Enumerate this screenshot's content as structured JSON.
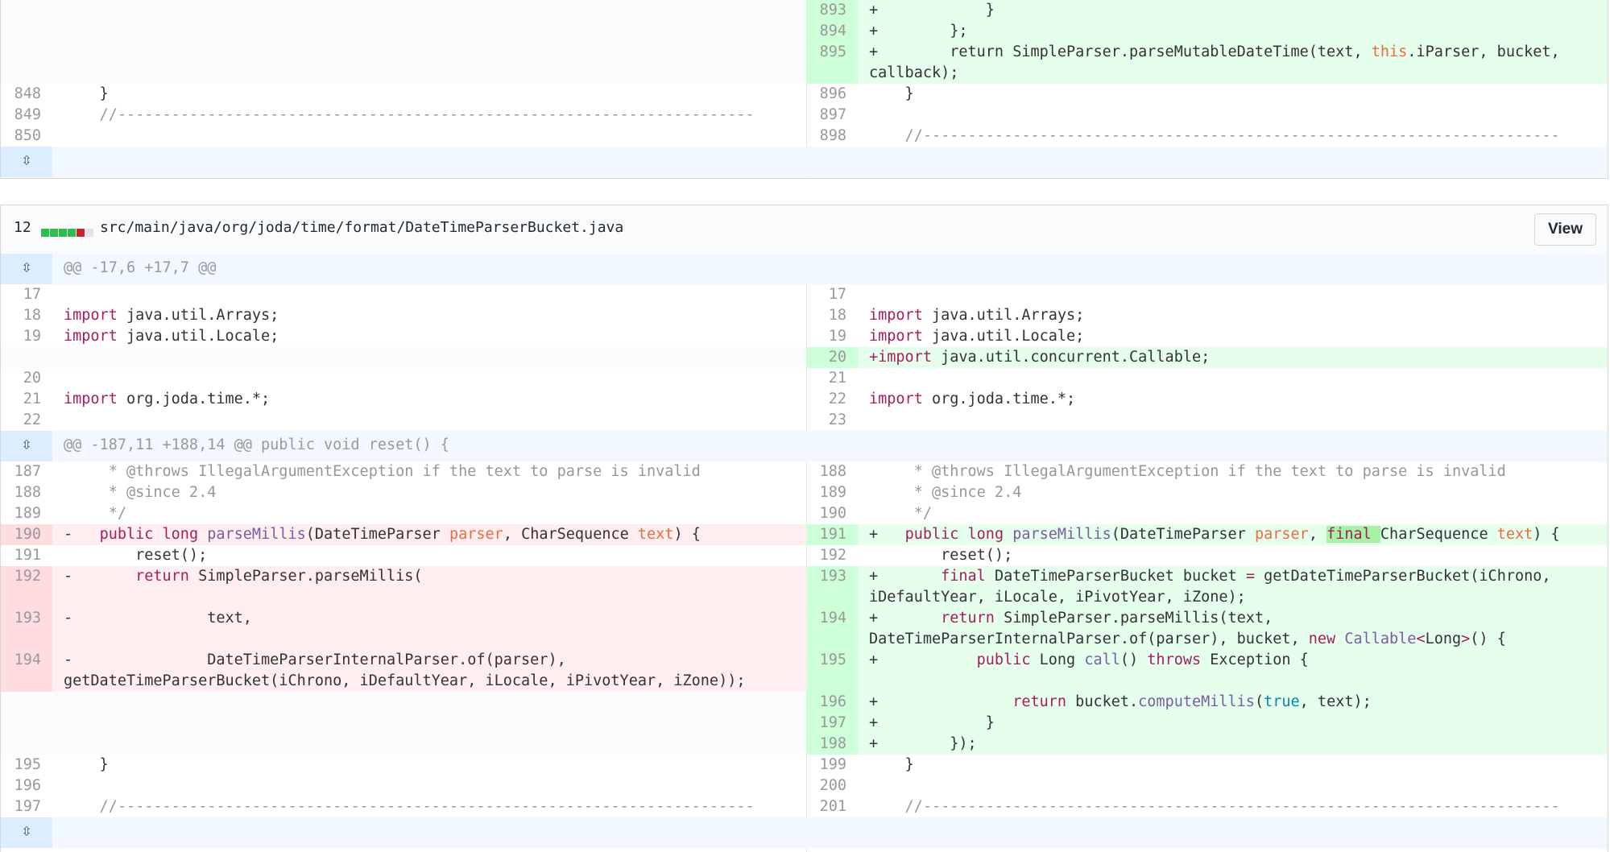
{
  "top_diff": {
    "right_only_rows": [
      {
        "num": "893",
        "code": "+            }"
      },
      {
        "num": "894",
        "code": "+        };"
      },
      {
        "num": "895",
        "code_pre": "+        return SimpleParser.parseMutableDateTime(text, ",
        "kw": "this",
        "code_post": ".iParser, bucket,",
        "cont": "callback);"
      }
    ],
    "context_rows": [
      {
        "l": "848",
        "r": "896",
        "code": "    }"
      },
      {
        "l": "849",
        "r": "897",
        "code": ""
      },
      {
        "l": "850",
        "r": "898",
        "code_l": "    //-----------------------------------------------------------------------",
        "code_r": "    //-----------------------------------------------------------------------"
      }
    ]
  },
  "file": {
    "changes_count": "12",
    "diffstat_colors": [
      "#2cbe4e",
      "#2cbe4e",
      "#2cbe4e",
      "#2cbe4e",
      "#cb2431",
      "#e1e4e8"
    ],
    "path": "src/main/java/org/joda/time/format/DateTimeParserBucket.java",
    "view_button": "View",
    "hunk1": "@@ -17,6 +17,7 @@",
    "hunk2": "@@ -187,11 +188,14 @@ public void reset() {",
    "h1_rows": [
      {
        "l": "17",
        "r": "17"
      },
      {
        "l": "18",
        "r": "18",
        "kw": "import",
        "rest": " java.util.Arrays;"
      },
      {
        "l": "19",
        "r": "19",
        "kw": "import",
        "rest": " java.util.Locale;"
      },
      {
        "r": "20",
        "added_kw": "+import",
        "added_rest": " java.util.concurrent.Callable;"
      },
      {
        "l": "20",
        "r": "21"
      },
      {
        "l": "21",
        "r": "22",
        "kw": "import",
        "rest": " org.joda.time.*;"
      },
      {
        "l": "22",
        "r": "23"
      }
    ],
    "h2_context": [
      {
        "l": "187",
        "r": "188",
        "code": "     * @throws IllegalArgumentException if the text to parse is invalid"
      },
      {
        "l": "188",
        "r": "189",
        "code": "     * @since 2.4"
      },
      {
        "l": "189",
        "r": "190",
        "code": "     */"
      }
    ],
    "deleted": {
      "l190": "190",
      "l192": "192",
      "l193": "193",
      "l194": "194",
      "t193": "-               text,",
      "t194a": "-               DateTimeParserInternalParser.of(parser),",
      "t194b": "getDateTimeParserBucket(iChrono, iDefaultYear, iLocale, iPivotYear, iZone));"
    },
    "added": {
      "r191": "191",
      "r193": "193",
      "r194": "194",
      "r195": "195",
      "r196": "196",
      "r197": "197",
      "r198": "198",
      "t193b": "iDefaultYear, iLocale, iPivotYear, iZone);",
      "t194b": "DateTimeParserInternalParser.of(parser), bucket, ",
      "t197": "+            }",
      "t198": "+        });"
    },
    "reset_row": {
      "l": "191",
      "r": "192",
      "code": "        reset();"
    },
    "tail_rows": [
      {
        "l": "195",
        "r": "199",
        "code": "    }"
      },
      {
        "l": "196",
        "r": "200",
        "code": ""
      },
      {
        "l": "197",
        "r": "201",
        "code": "    //-----------------------------------------------------------------------"
      }
    ]
  }
}
